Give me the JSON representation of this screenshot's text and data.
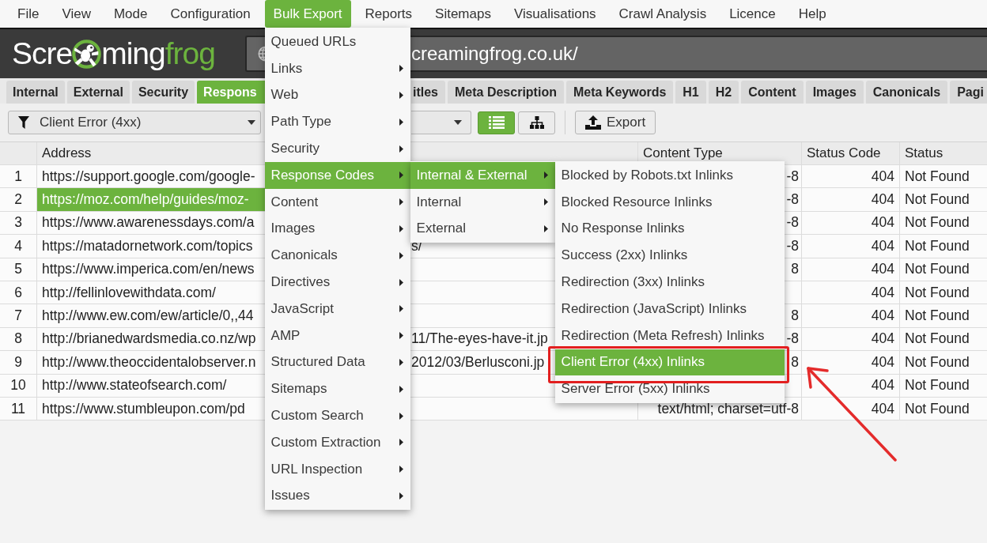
{
  "menu_bar": [
    {
      "label": "File",
      "selected": false
    },
    {
      "label": "View",
      "selected": false
    },
    {
      "label": "Mode",
      "selected": false
    },
    {
      "label": "Configuration",
      "selected": false
    },
    {
      "label": "Bulk Export",
      "selected": true,
      "children": [
        {
          "label": "Queued URLs",
          "has_submenu": false,
          "selected": false
        },
        {
          "label": "Links",
          "has_submenu": true,
          "selected": false
        },
        {
          "label": "Web",
          "has_submenu": true,
          "selected": false
        },
        {
          "label": "Path Type",
          "has_submenu": true,
          "selected": false
        },
        {
          "label": "Security",
          "has_submenu": true,
          "selected": false
        },
        {
          "label": "Response Codes",
          "has_submenu": true,
          "selected": true,
          "children": [
            {
              "label": "Internal & External",
              "has_submenu": true,
              "selected": true,
              "children": [
                {
                  "label": "Blocked by Robots.txt Inlinks",
                  "has_submenu": false,
                  "selected": false
                },
                {
                  "label": "Blocked Resource Inlinks",
                  "has_submenu": false,
                  "selected": false
                },
                {
                  "label": "No Response Inlinks",
                  "has_submenu": false,
                  "selected": false
                },
                {
                  "label": "Success (2xx) Inlinks",
                  "has_submenu": false,
                  "selected": false
                },
                {
                  "label": "Redirection (3xx) Inlinks",
                  "has_submenu": false,
                  "selected": false
                },
                {
                  "label": "Redirection (JavaScript) Inlinks",
                  "has_submenu": false,
                  "selected": false
                },
                {
                  "label": "Redirection (Meta Refresh) Inlinks",
                  "has_submenu": false,
                  "selected": false
                },
                {
                  "label": "Client Error (4xx) Inlinks",
                  "has_submenu": false,
                  "selected": true
                },
                {
                  "label": "Server Error (5xx) Inlinks",
                  "has_submenu": false,
                  "selected": false
                }
              ]
            },
            {
              "label": "Internal",
              "has_submenu": true,
              "selected": false
            },
            {
              "label": "External",
              "has_submenu": true,
              "selected": false
            }
          ]
        },
        {
          "label": "Content",
          "has_submenu": true,
          "selected": false
        },
        {
          "label": "Images",
          "has_submenu": true,
          "selected": false
        },
        {
          "label": "Canonicals",
          "has_submenu": true,
          "selected": false
        },
        {
          "label": "Directives",
          "has_submenu": true,
          "selected": false
        },
        {
          "label": "JavaScript",
          "has_submenu": true,
          "selected": false
        },
        {
          "label": "AMP",
          "has_submenu": true,
          "selected": false
        },
        {
          "label": "Structured Data",
          "has_submenu": true,
          "selected": false
        },
        {
          "label": "Sitemaps",
          "has_submenu": true,
          "selected": false
        },
        {
          "label": "Custom Search",
          "has_submenu": true,
          "selected": false
        },
        {
          "label": "Custom Extraction",
          "has_submenu": true,
          "selected": false
        },
        {
          "label": "URL Inspection",
          "has_submenu": true,
          "selected": false
        },
        {
          "label": "Issues",
          "has_submenu": true,
          "selected": false
        }
      ]
    },
    {
      "label": "Reports",
      "selected": false
    },
    {
      "label": "Sitemaps",
      "selected": false
    },
    {
      "label": "Visualisations",
      "selected": false
    },
    {
      "label": "Crawl Analysis",
      "selected": false
    },
    {
      "label": "Licence",
      "selected": false
    },
    {
      "label": "Help",
      "selected": false
    }
  ],
  "logo": {
    "lead": "Scre",
    "middle": "ming",
    "accent": "frog"
  },
  "url_field": {
    "value": "creamingfrog.co.uk/"
  },
  "tabs": [
    {
      "label": "Internal",
      "selected": false,
      "clipped": false
    },
    {
      "label": "External",
      "selected": false,
      "clipped": false
    },
    {
      "label": "Security",
      "selected": false,
      "clipped": false
    },
    {
      "label": "Respons",
      "selected": true,
      "clipped": true
    },
    {
      "label": "itles",
      "selected": false,
      "clipped": true
    },
    {
      "label": "Meta Description",
      "selected": false,
      "clipped": false
    },
    {
      "label": "Meta Keywords",
      "selected": false,
      "clipped": false
    },
    {
      "label": "H1",
      "selected": false,
      "clipped": false
    },
    {
      "label": "H2",
      "selected": false,
      "clipped": false
    },
    {
      "label": "Content",
      "selected": false,
      "clipped": false
    },
    {
      "label": "Images",
      "selected": false,
      "clipped": false
    },
    {
      "label": "Canonicals",
      "selected": false,
      "clipped": false
    },
    {
      "label": "Pagi",
      "selected": false,
      "clipped": true
    }
  ],
  "filter_bar": {
    "filter": "Client Error (4xx)",
    "view_buttons": [
      {
        "kind": "list",
        "selected": true
      },
      {
        "kind": "tree",
        "selected": false
      }
    ],
    "export_button": "Export"
  },
  "table": {
    "columns": [
      "Address",
      "Content Type",
      "Status Code",
      "Status"
    ],
    "rows": [
      {
        "number": "1",
        "address": "https://support.google.com/google-",
        "content_type": "-8",
        "status_code": "404",
        "status": "Not Found",
        "selected": false
      },
      {
        "number": "2",
        "address": "https://moz.com/help/guides/moz-",
        "content_type": "-8",
        "status_code": "404",
        "status": "Not Found",
        "selected": true
      },
      {
        "number": "3",
        "address": "https://www.awarenessdays.com/a",
        "content_type": "-8",
        "status_code": "404",
        "status": "Not Found",
        "selected": false
      },
      {
        "number": "4",
        "address": "https://matadornetwork.com/topics",
        "address_tail": "s/",
        "content_type": "-8",
        "status_code": "404",
        "status": "Not Found",
        "selected": false
      },
      {
        "number": "5",
        "address": "https://www.imperica.com/en/news",
        "content_type": "8",
        "status_code": "404",
        "status": "Not Found",
        "selected": false
      },
      {
        "number": "6",
        "address": "http://fellinlovewithdata.com/",
        "status_code": "404",
        "status": "Not Found",
        "selected": false
      },
      {
        "number": "7",
        "address": "http://www.ew.com/ew/article/0,,44",
        "content_type": "8",
        "status_code": "404",
        "status": "Not Found",
        "selected": false
      },
      {
        "number": "8",
        "address": "http://brianedwardsmedia.co.nz/wp",
        "address_tail": "11/The-eyes-have-it.jp",
        "content_type": "-8",
        "status_code": "404",
        "status": "Not Found",
        "selected": false
      },
      {
        "number": "9",
        "address": "http://www.theoccidentalobserver.n",
        "address_tail": "2012/03/Berlusconi.jp",
        "content_type": "8",
        "status_code": "404",
        "status": "Not Found",
        "selected": false
      },
      {
        "number": "10",
        "address": "http://www.stateofsearch.com/",
        "status_code": "404",
        "status": "Not Found",
        "selected": false
      },
      {
        "number": "11",
        "address": "https://www.stumbleupon.com/pd",
        "content_type": "text/html; charset=utf-8",
        "status_code": "404",
        "status": "Not Found",
        "selected": false
      }
    ]
  }
}
